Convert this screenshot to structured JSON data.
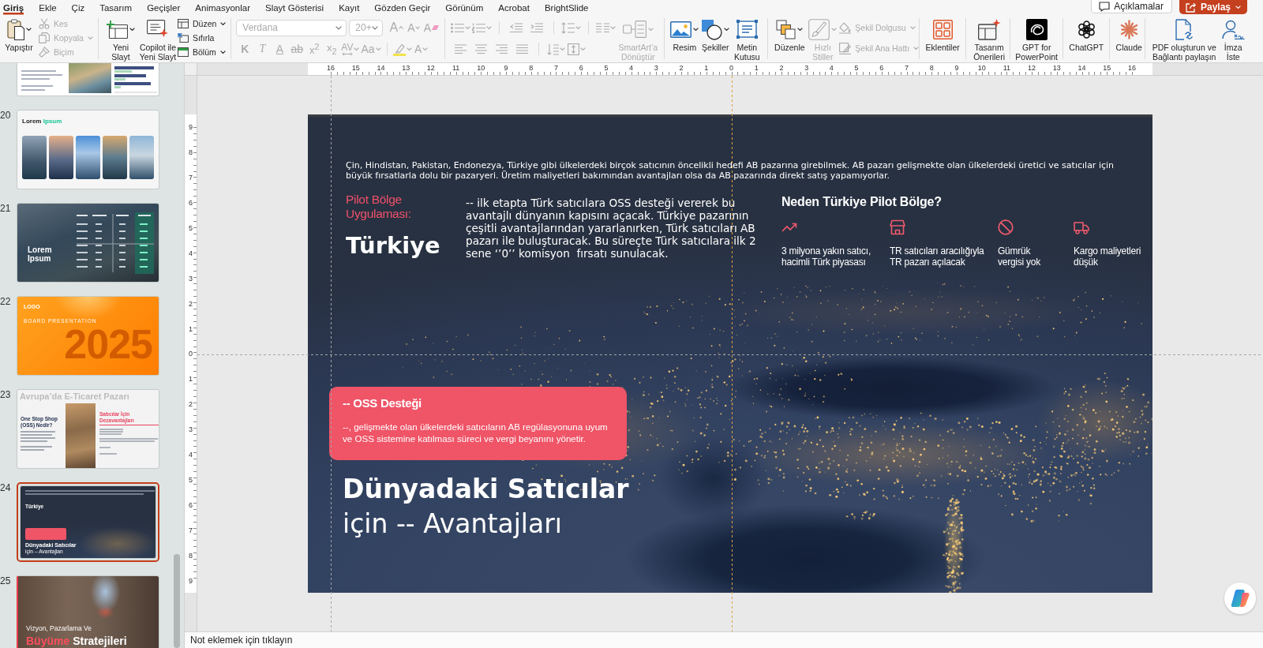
{
  "menu": {
    "tabs": [
      {
        "label": "Giriş",
        "selected": true
      },
      {
        "label": "Ekle",
        "selected": false
      },
      {
        "label": "Çiz",
        "selected": false
      },
      {
        "label": "Tasarım",
        "selected": false
      },
      {
        "label": "Geçişler",
        "selected": false
      },
      {
        "label": "Animasyonlar",
        "selected": false
      },
      {
        "label": "Slayt Gösterisi",
        "selected": false
      },
      {
        "label": "Kayıt",
        "selected": false
      },
      {
        "label": "Gözden Geçir",
        "selected": false
      },
      {
        "label": "Görünüm",
        "selected": false
      },
      {
        "label": "Acrobat",
        "selected": false
      },
      {
        "label": "BrightSlide",
        "selected": false
      }
    ],
    "comments_button": {
      "label": "Açıklamalar"
    },
    "share_button": {
      "label": "Paylaş"
    }
  },
  "ribbon": {
    "clipboard": {
      "paste": {
        "label": "Yapıştır"
      },
      "cut": {
        "label": "Kes",
        "disabled": true
      },
      "copy": {
        "label": "Kopyala",
        "disabled": true
      },
      "format_painter": {
        "label": "Biçim",
        "disabled": true
      }
    },
    "slides": {
      "new_slide": {
        "label": "Yeni Slayt"
      },
      "copilot_new_slide": {
        "label": "Copilot ile Yeni Slayt"
      },
      "layout": {
        "label": "Düzen"
      },
      "reset": {
        "label": "Sıfırla"
      },
      "section": {
        "label": "Bölüm"
      }
    },
    "font": {
      "disabled": true,
      "font_name": "Verdana",
      "font_size": "20+",
      "grow": "A",
      "shrink": "A",
      "clear": "A",
      "format": [
        "K",
        "T",
        "A",
        "ab",
        "x$^{2}$",
        "x$_{2}$",
        "AV",
        "Aa"
      ],
      "font_color": "A"
    },
    "paragraph": {
      "disabled": true
    },
    "smartart": {
      "label": "SmartArt’a Dönüştür",
      "disabled": true
    },
    "insert": {
      "picture": {
        "label": "Resim"
      },
      "shapes": {
        "label": "Şekiller"
      },
      "text_box": {
        "label": "Metin Kutusu"
      }
    },
    "drawing": {
      "arrange": {
        "label": "Düzenle"
      },
      "quick_styles": {
        "label": "Hızlı Stiller",
        "disabled": true
      },
      "shape_fill": {
        "label": "Şekil Dolgusu",
        "disabled": true
      },
      "shape_outline": {
        "label": "Şekil Ana Hattı",
        "disabled": true
      }
    },
    "add_ins": {
      "add_ins": {
        "label": "Eklentiler"
      },
      "designer": {
        "label": "Tasarım Önerileri"
      },
      "gpt": {
        "label": "GPT for PowerPoint"
      },
      "chatgpt": {
        "label": "ChatGPT"
      },
      "claude": {
        "label": "Claude"
      },
      "pdf_share": {
        "label": "PDF oluşturun ve Bağlantı paylaşın"
      },
      "signature": {
        "label": "İmza İste"
      }
    }
  },
  "rulers": {
    "horizontal": [
      "16",
      "15",
      "14",
      "13",
      "12",
      "11",
      "10",
      "9",
      "8",
      "7",
      "6",
      "5",
      "4",
      "3",
      "2",
      "1",
      "0",
      "1",
      "2",
      "3",
      "4",
      "5",
      "6",
      "7",
      "8",
      "9",
      "10",
      "11",
      "12",
      "13",
      "14",
      "15",
      "16"
    ],
    "vertical": [
      "9",
      "8",
      "7",
      "6",
      "5",
      "4",
      "3",
      "2",
      "1",
      "0",
      "1",
      "2",
      "3",
      "4",
      "5",
      "6",
      "7",
      "8",
      "9"
    ]
  },
  "slide_panel": {
    "slides": [
      {
        "kind": "report",
        "selected": false
      },
      {
        "kind": "gallery",
        "number": "20",
        "title": "Lorem",
        "title_accent": "Ipsum",
        "selected": false
      },
      {
        "kind": "table",
        "number": "21",
        "title": "Lorem Ipsum",
        "selected": false
      },
      {
        "kind": "cover",
        "number": "22",
        "logo": "LOGO",
        "subtitle": "BOARD PRESENTATION",
        "year": "2025",
        "selected": false
      },
      {
        "kind": "split",
        "number": "23",
        "header": "Avrupa’da E-Ticaret Pazarı",
        "heading": "One Stop Shop (OSS) Nedir?",
        "side_heading": "Satıcılar İçin Dezavantajları",
        "selected": false
      },
      {
        "kind": "map",
        "number": "24",
        "country": "Türkiye",
        "title": "Dünyadaki Satıcılar",
        "subtitle": "için -- Avantajları",
        "selected": true
      },
      {
        "kind": "photo_title",
        "number": "25",
        "line": "Vizyon, Pazarlama Ve",
        "accent": "Büyüme",
        "rest": "Stratejileri",
        "selected": false
      }
    ]
  },
  "slide": {
    "intro": "Çin, Hindistan, Pakistan, Endonezya, Türkiye gibi ülkelerdeki birçok satıcının öncelikli hedefi AB pazarına girebilmek. AB pazarı gelişmekte olan ülkelerdeki üretici ve satıcılar için büyük fırsatlarla dolu bir pazaryeri. Üretim maliyetleri bakımından avantajları olsa da AB pazarında direkt satış yapamıyorlar.",
    "pilot_label": "Pilot Bölge Uygulaması:",
    "country": "Türkiye",
    "description": "-- ilk etapta Türk satıcılara OSS desteği vererek bu avantajlı dünyanın kapısını açacak. Türkiye pazarının çeşitli avantajlarından yararlanırken, Türk satıcıları AB pazarı ile buluşturacak. Bu süreçte Türk satıcılara ilk 2 sene ‘’0’’ komisyon  fırsatı sunulacak.",
    "reasons_title": "Neden Türkiye Pilot Bölge?",
    "reasons": [
      {
        "text": "3 milyona yakın satıcı, hacimli Türk piyasası"
      },
      {
        "text": "TR satıcıları aracılığıyla TR pazarı açılacak"
      },
      {
        "text": "Gümrük vergisi yok"
      },
      {
        "text": "Kargo maliyetleri düşük"
      }
    ],
    "callout": {
      "title": "-- OSS Desteği",
      "body": "--, gelişmekte olan ülkelerdeki satıcıların AB regülasyonuna uyum ve OSS sistemine katılması süreci ve vergi beyanını yönetir."
    },
    "title": "Dünyadaki Satıcılar",
    "subtitle": "için -- Avantajları"
  },
  "notes": {
    "placeholder": "Not eklemek için tıklayın"
  }
}
